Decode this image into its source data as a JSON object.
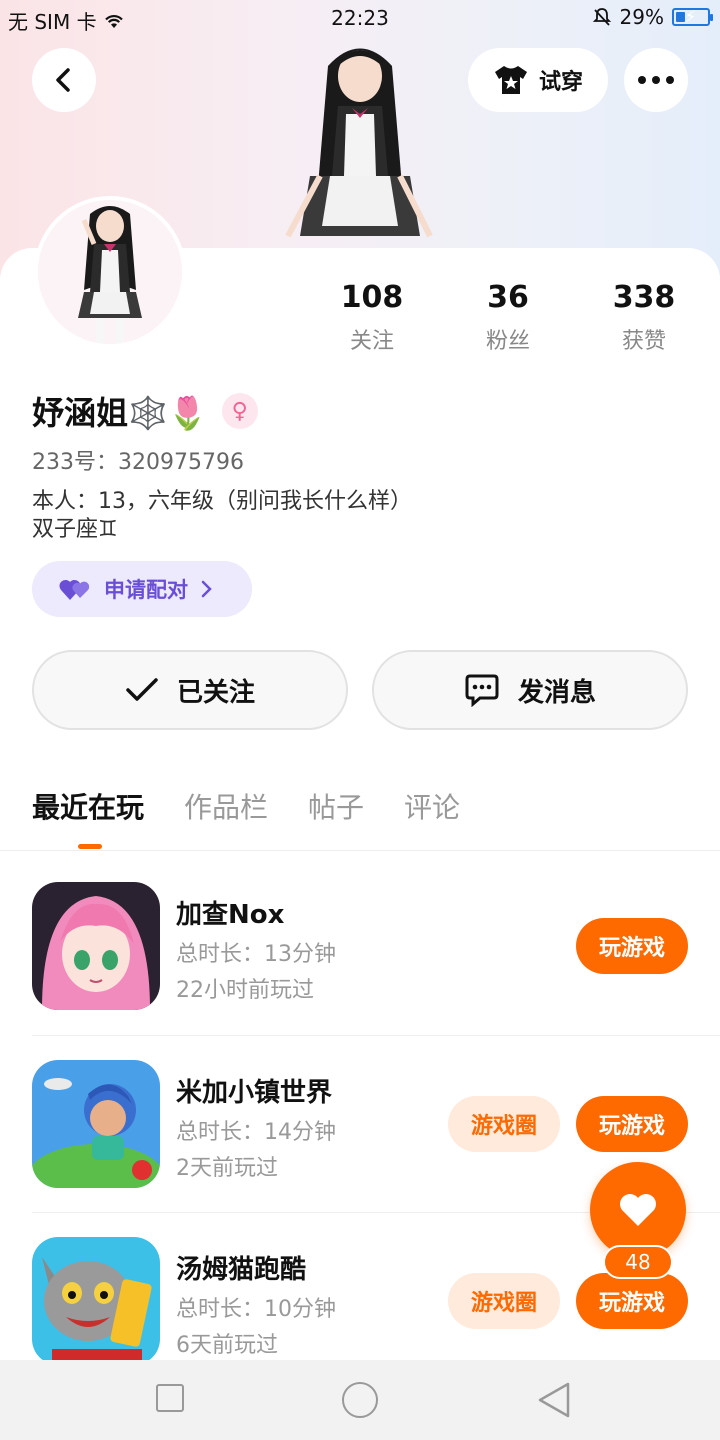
{
  "status_bar": {
    "carrier": "无 SIM 卡",
    "time": "22:23",
    "battery": "29%",
    "battery_level": 0.29
  },
  "header": {
    "try_on_label": "试穿",
    "icons": [
      "back-arrow-icon",
      "shirt-icon",
      "more-dots-icon"
    ]
  },
  "profile": {
    "stats": [
      {
        "value": "108",
        "label": "关注"
      },
      {
        "value": "36",
        "label": "粉丝"
      },
      {
        "value": "338",
        "label": "获赞"
      }
    ],
    "name": "妤涵姐🕸️🌷",
    "gender_symbol": "♀",
    "uid": "233号：320975796",
    "bio_line1": "本人：13，六年级（别问我长什么样）",
    "bio_line2": "双子座♊",
    "pair_label": "申请配对",
    "followed_label": "已关注",
    "message_label": "发消息"
  },
  "tabs": [
    "最近在玩",
    "作品栏",
    "帖子",
    "评论"
  ],
  "games": [
    {
      "name": "加查Nox",
      "duration": "总时长：13分钟",
      "last_played": "22小时前玩过",
      "play_label": "玩游戏"
    },
    {
      "name": "米加小镇世界",
      "duration": "总时长：14分钟",
      "last_played": "2天前玩过",
      "circle_label": "游戏圈",
      "play_label": "玩游戏"
    },
    {
      "name": "汤姆猫跑酷",
      "duration": "总时长：10分钟",
      "last_played": "6天前玩过",
      "circle_label": "游戏圈",
      "play_label": "玩游戏"
    }
  ],
  "fab": {
    "count": "48"
  },
  "colors": {
    "accent": "#ff6a00",
    "pair_purple": "#6a4fd6"
  }
}
